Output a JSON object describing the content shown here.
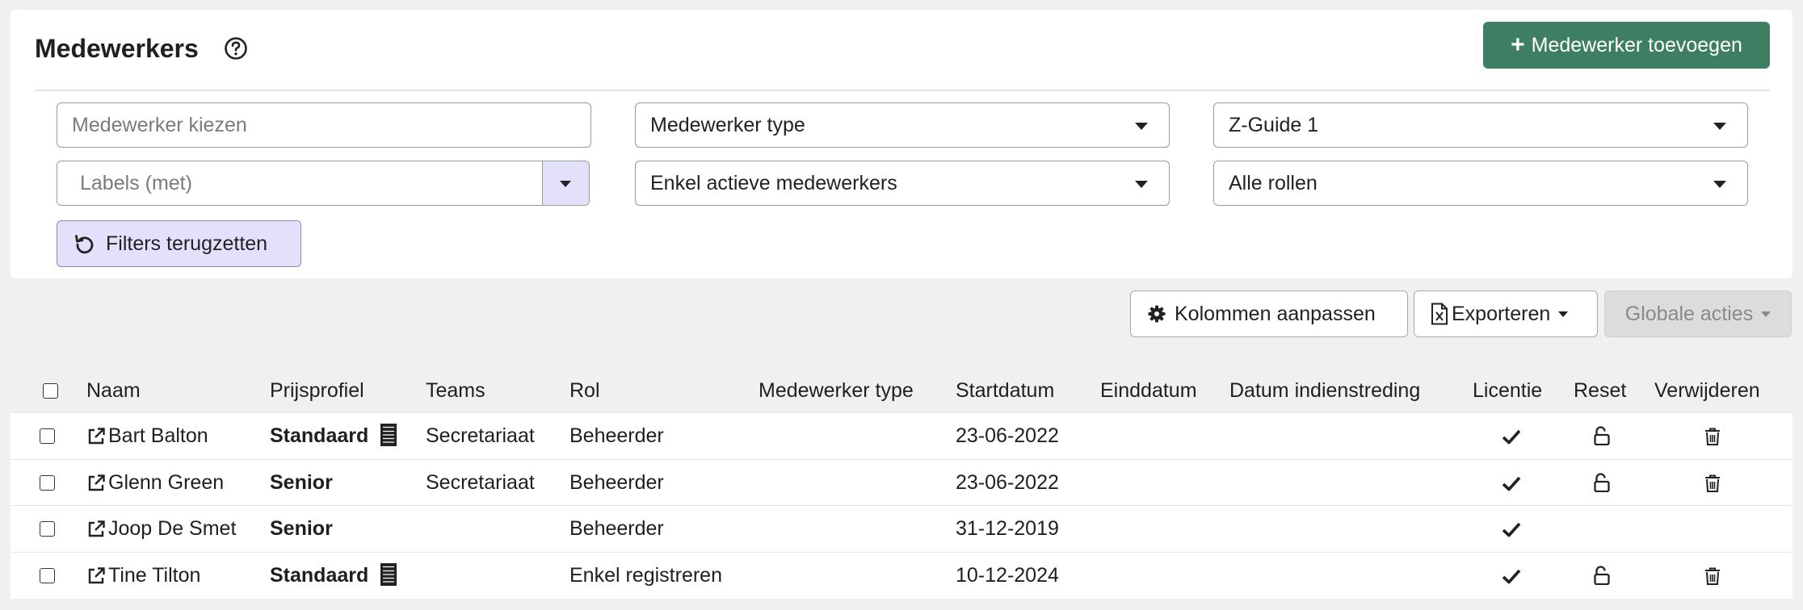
{
  "header": {
    "title": "Medewerkers",
    "add_button_label": "Medewerker toevoegen"
  },
  "filters": {
    "employee_placeholder": "Medewerker kiezen",
    "employee_type": "Medewerker type",
    "z_guide": "Z-Guide 1",
    "labels_placeholder": "Labels (met)",
    "active_filter": "Enkel actieve medewerkers",
    "roles": "Alle rollen",
    "reset_label": "Filters terugzetten"
  },
  "toolbar": {
    "columns_label": "Kolommen aanpassen",
    "export_label": "Exporteren",
    "global_actions_label": "Globale acties"
  },
  "table": {
    "columns": [
      "Naam",
      "Prijsprofiel",
      "Teams",
      "Rol",
      "Medewerker type",
      "Startdatum",
      "Einddatum",
      "Datum indienstreding",
      "Licentie",
      "Reset",
      "Verwijderen"
    ],
    "rows": [
      {
        "name": "Bart Balton",
        "price_profile": "Standaard",
        "teams": "Secretariaat",
        "role": "Beheerder",
        "employee_type": "",
        "start_date": "23-06-2022",
        "end_date": "",
        "employment_date": ""
      },
      {
        "name": "Glenn Green",
        "price_profile": "Senior",
        "teams": "Secretariaat",
        "role": "Beheerder",
        "employee_type": "",
        "start_date": "23-06-2022",
        "end_date": "",
        "employment_date": ""
      },
      {
        "name": "Joop De Smet",
        "price_profile": "Senior",
        "teams": "",
        "role": "Beheerder",
        "employee_type": "",
        "start_date": "31-12-2019",
        "end_date": "",
        "employment_date": ""
      },
      {
        "name": "Tine Tilton",
        "price_profile": "Standaard",
        "teams": "",
        "role": "Enkel registreren",
        "employee_type": "",
        "start_date": "10-12-2024",
        "end_date": "",
        "employment_date": ""
      }
    ]
  },
  "icons": {
    "help": "question-circle-icon",
    "reset": "undo-icon",
    "columns": "gear-icon",
    "export": "excel-file-icon",
    "external_link": "external-link-icon",
    "license": "check-icon",
    "reset_password": "unlock-icon",
    "delete": "trash-icon",
    "price_list": "stack-icon"
  },
  "colors": {
    "primary": "#3e7f64",
    "accent_light": "#e3e0fb",
    "background": "#f0f0f0"
  }
}
